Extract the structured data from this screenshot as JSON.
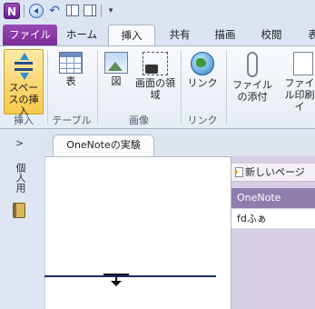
{
  "app": {
    "icon_letter": "N"
  },
  "tabs": [
    "ファイル",
    "ホーム",
    "挿入",
    "共有",
    "描画",
    "校閲",
    "表"
  ],
  "active_tab": "挿入",
  "ribbon": {
    "buttons": {
      "insert_space": "スペースの挿入",
      "table": "表",
      "picture": "図",
      "screen_clipping": "画面の領域",
      "link": "リンク",
      "attach_file": "ファイルの添付",
      "file_printout": "ファイル印刷イ"
    },
    "groups": {
      "insert": "挿入",
      "tables": "テーブル",
      "images": "画像",
      "links": "リンク"
    }
  },
  "navigation": {
    "expand_glyph": ">",
    "notebook": "個人用"
  },
  "section_tab": "OneNoteの実験",
  "page_list": {
    "new_page": "新しいページ",
    "pages": [
      "OneNote",
      "fdふぁ"
    ]
  },
  "colors": {
    "file_tab": "#7a2b98",
    "selected_button": "#f7c948",
    "page_selected": "#8e7eae"
  }
}
